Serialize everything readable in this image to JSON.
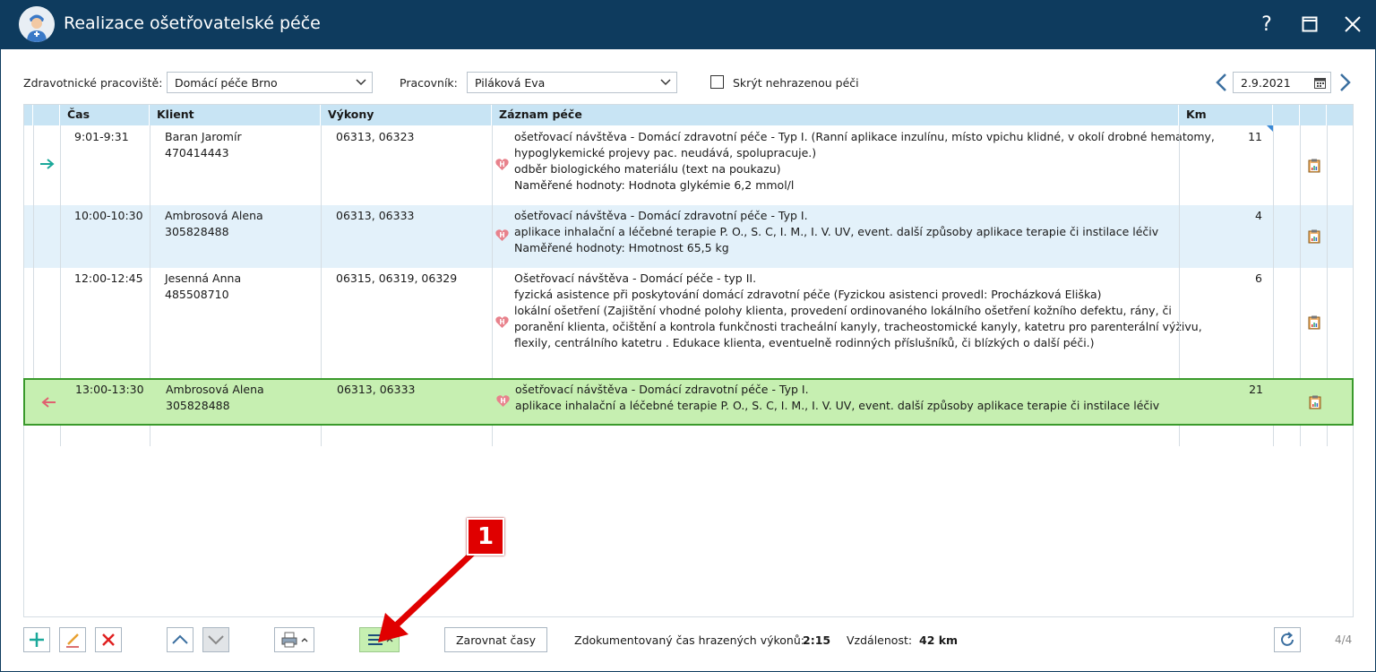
{
  "window": {
    "title": "Realizace ošetřovatelské péče",
    "help_label": "?"
  },
  "filters": {
    "workplace_label": "Zdravotnické pracoviště:",
    "workplace_value": "Domácí péče Brno",
    "worker_label": "Pracovník:",
    "worker_value": "Piláková Eva",
    "hide_unpaid_label": "Skrýt nehrazenou péči",
    "hide_unpaid_checked": false,
    "date_value": "2.9.2021"
  },
  "grid": {
    "columns": [
      "Čas",
      "Klient",
      "Výkony",
      "Záznam péče",
      "Km"
    ],
    "rows": [
      {
        "arrow": "right",
        "time": "9:01-9:31",
        "client_name": "Baran Jaromír",
        "client_id": "470414443",
        "procedures": "06313, 06323",
        "care": [
          "ošetřovací návštěva - Domácí zdravotní péče - Typ I. (Ranní aplikace inzulínu, místo vpichu klidné, v okolí drobné hematomy,",
          "hypoglykemické projevy pac. neudává, spolupracuje.)",
          "odběr biologického materiálu (text na poukazu)",
          "Naměřené hodnoty: Hodnota glykémie 6,2 mmol/l"
        ],
        "km": "11"
      },
      {
        "arrow": "",
        "time": "10:00-10:30",
        "client_name": "Ambrosová Alena",
        "client_id": "305828488",
        "procedures": "06313, 06333",
        "care": [
          "ošetřovací návštěva - Domácí zdravotní péče - Typ I.",
          "aplikace inhalační a léčebné terapie P. O., S. C, I. M., I. V. UV, event. další způsoby aplikace terapie či instilace léčiv",
          "Naměřené hodnoty: Hmotnost 65,5 kg"
        ],
        "km": "4"
      },
      {
        "arrow": "",
        "time": "12:00-12:45",
        "client_name": "Jesenná Anna",
        "client_id": "485508710",
        "procedures": "06315, 06319, 06329",
        "care": [
          "Ošetřovací návštěva - Domácí péče - typ II.",
          "fyzická asistence při poskytování domácí zdravotní péče (Fyzickou asistenci provedl: Procházková Eliška)",
          "lokální ošetření (Zajištění vhodné polohy klienta, provedení ordinovaného lokálního ošetření kožního defektu, rány, či",
          "poranění klienta, očištění a kontrola funkčnosti tracheální kanyly, tracheostomické kanyly, katetru pro parenterální výživu,",
          "flexily, centrálního katetru . Edukace klienta, eventuelně rodinných příslušníků, či blízkých o další péči.)"
        ],
        "km": "6"
      },
      {
        "arrow": "left",
        "time": "13:00-13:30",
        "client_name": "Ambrosová Alena",
        "client_id": "305828488",
        "procedures": "06313, 06333",
        "care": [
          "ošetřovací návštěva - Domácí zdravotní péče - Typ I.",
          "aplikace inhalační a léčebné terapie P. O., S. C, I. M., I. V. UV, event. další způsoby aplikace terapie či instilace léčiv"
        ],
        "km": "21"
      }
    ]
  },
  "toolbar": {
    "align_times_label": "Zarovnat časy",
    "documented_time_label": "Zdokumentovaný čas hrazených výkonů:",
    "documented_time_value": "2:15",
    "distance_label": "Vzdálenost:",
    "distance_value": "42 km",
    "pager": "4/4"
  },
  "annotation": {
    "callout_number": "1"
  },
  "colors": {
    "titlebar": "#0e3b5e",
    "header": "#c8e4f4",
    "row_alt": "#e3f1fa",
    "row_selected": "#c6efb1",
    "selected_border": "#3a9a2c",
    "callout": "#e00000"
  }
}
